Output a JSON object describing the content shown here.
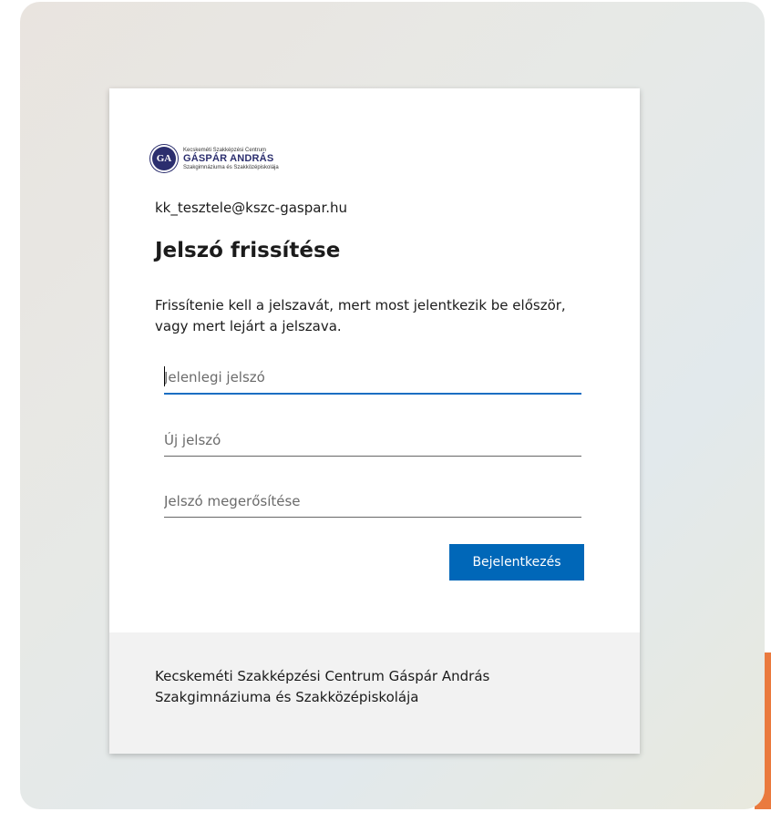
{
  "colors": {
    "primary_button": "#0067b8",
    "accent_bar": "#ea7a3e",
    "logo_navy": "#2b2e6e",
    "focus_underline": "#1b6ec2"
  },
  "logo": {
    "initials": "GA",
    "line1": "Kecskeméti Szakképzési Centrum",
    "line2": "GÁSPÁR ANDRÁS",
    "line3": "Szakgimnáziuma és Szakközépiskolája"
  },
  "account": {
    "email": "kk_tesztele@kszc-gaspar.hu"
  },
  "form": {
    "title": "Jelszó frissítése",
    "description": "Frissítenie kell a jelszavát, mert most jelentkezik be először, vagy mert lejárt a jelszava.",
    "current_password_placeholder": "Jelenlegi jelszó",
    "new_password_placeholder": "Új jelszó",
    "confirm_password_placeholder": "Jelszó megerősítése",
    "submit_label": "Bejelentkezés"
  },
  "footer": {
    "organization": "Kecskeméti Szakképzési Centrum Gáspár András Szakgimnáziuma és Szakközépiskolája"
  }
}
